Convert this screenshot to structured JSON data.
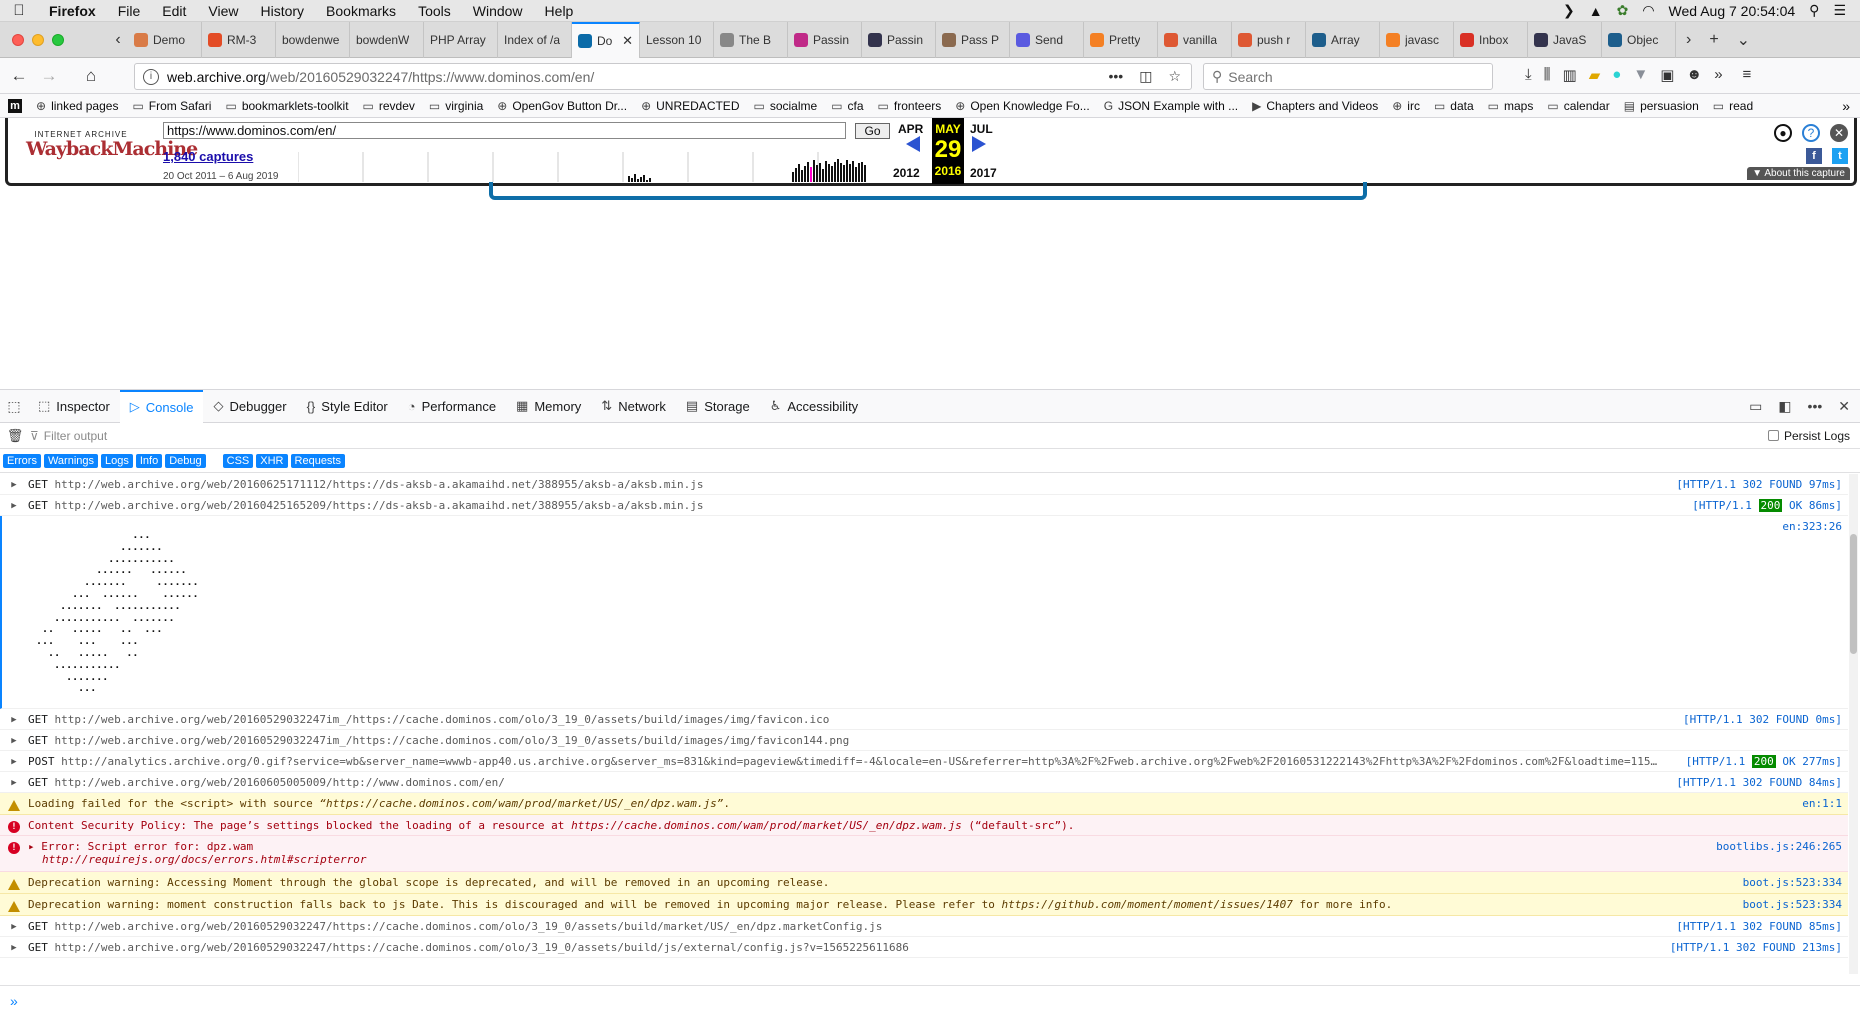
{
  "menubar": {
    "app": "Firefox",
    "items": [
      "File",
      "Edit",
      "View",
      "History",
      "Bookmarks",
      "Tools",
      "Window",
      "Help"
    ],
    "clock": "Wed Aug 7  20:54:04"
  },
  "tabs": [
    {
      "title": "Demo",
      "icon": "slides-icon",
      "color": "#d97b47"
    },
    {
      "title": "RM-3",
      "icon": "grid-icon",
      "color": "#e34c26"
    },
    {
      "title": "bowdenwe",
      "icon": "",
      "color": ""
    },
    {
      "title": "bowdenW",
      "icon": "",
      "color": ""
    },
    {
      "title": "PHP Array",
      "icon": "",
      "color": ""
    },
    {
      "title": "Index of /a",
      "icon": "",
      "color": ""
    },
    {
      "title": "Do",
      "icon": "dominos-icon",
      "color": "#0b6ba8",
      "active": true
    },
    {
      "title": "Lesson 10",
      "icon": "",
      "color": ""
    },
    {
      "title": "The B",
      "icon": "book-icon",
      "color": "#888888"
    },
    {
      "title": "Passin",
      "icon": "grid-icon",
      "color": "#c02a88"
    },
    {
      "title": "Passin",
      "icon": "dw-icon",
      "color": "#33334d"
    },
    {
      "title": "Pass P",
      "icon": "avatar-icon",
      "color": "#8b6a4f"
    },
    {
      "title": "Send",
      "icon": "send-icon",
      "color": "#5a5ae0"
    },
    {
      "title": "Pretty",
      "icon": "stack-icon",
      "color": "#f48024"
    },
    {
      "title": "vanilla",
      "icon": "ddg-icon",
      "color": "#de5833"
    },
    {
      "title": "push r",
      "icon": "ddg-icon",
      "color": "#de5833"
    },
    {
      "title": "Array",
      "icon": "mdn-icon",
      "color": "#1d5e8c"
    },
    {
      "title": "javasc",
      "icon": "stack-icon",
      "color": "#f48024"
    },
    {
      "title": "Inbox",
      "icon": "gmail-icon",
      "color": "#d93025"
    },
    {
      "title": "JavaS",
      "icon": "dw-icon",
      "color": "#33334d"
    },
    {
      "title": "Objec",
      "icon": "mdn-icon",
      "color": "#1d5e8c"
    }
  ],
  "url": {
    "domain": "web.archive.org",
    "path": "/web/20160529032247/https://www.dominos.com/en/"
  },
  "search": {
    "placeholder": "Search"
  },
  "bookmarks": [
    {
      "label": "linked pages",
      "icon": "globe-icon"
    },
    {
      "label": "From Safari",
      "icon": "folder-icon"
    },
    {
      "label": "bookmarklets-toolkit",
      "icon": "folder-icon"
    },
    {
      "label": "revdev",
      "icon": "folder-icon"
    },
    {
      "label": "virginia",
      "icon": "folder-icon"
    },
    {
      "label": "OpenGov Button Dr...",
      "icon": "globe-icon"
    },
    {
      "label": "UNREDACTED",
      "icon": "globe-icon"
    },
    {
      "label": "socialme",
      "icon": "folder-icon"
    },
    {
      "label": "cfa",
      "icon": "folder-icon"
    },
    {
      "label": "fronteers",
      "icon": "folder-icon"
    },
    {
      "label": "Open Knowledge Fo...",
      "icon": "globe-icon"
    },
    {
      "label": "JSON Example with ...",
      "icon": "g-icon"
    },
    {
      "label": "Chapters and Videos",
      "icon": "video-icon"
    },
    {
      "label": "irc",
      "icon": "globe-icon"
    },
    {
      "label": "data",
      "icon": "folder-icon"
    },
    {
      "label": "maps",
      "icon": "folder-icon"
    },
    {
      "label": "calendar",
      "icon": "folder-icon"
    },
    {
      "label": "persuasion",
      "icon": "page-icon"
    },
    {
      "label": "read",
      "icon": "folder-icon"
    }
  ],
  "wayback": {
    "logo_top": "INTERNET ARCHIVE",
    "logo_main": "WaybackMachine",
    "url_value": "https://www.dominos.com/en/",
    "go": "Go",
    "captures": "1,840 captures",
    "range": "20 Oct 2011 – 6 Aug 2019",
    "prev_month": "APR",
    "cur_month": "MAY",
    "next_month": "JUL",
    "prev_year": "2012",
    "cur_day": "29",
    "cur_year": "2016",
    "next_year": "2017",
    "about": "About this capture"
  },
  "devtools": {
    "tabs": [
      {
        "label": "Inspector",
        "icon": "inspector-icon"
      },
      {
        "label": "Console",
        "icon": "console-icon",
        "active": true
      },
      {
        "label": "Debugger",
        "icon": "debugger-icon"
      },
      {
        "label": "Style Editor",
        "icon": "braces-icon"
      },
      {
        "label": "Performance",
        "icon": "gauge-icon"
      },
      {
        "label": "Memory",
        "icon": "memory-icon"
      },
      {
        "label": "Network",
        "icon": "network-icon"
      },
      {
        "label": "Storage",
        "icon": "storage-icon"
      },
      {
        "label": "Accessibility",
        "icon": "accessibility-icon"
      }
    ],
    "filter_placeholder": "Filter output",
    "persist_logs": "Persist Logs",
    "categories": [
      "Errors",
      "Warnings",
      "Logs",
      "Info",
      "Debug"
    ],
    "net_categories": [
      "CSS",
      "XHR",
      "Requests"
    ]
  },
  "console": [
    {
      "kind": "net",
      "method": "GET",
      "url": "http://web.archive.org/web/20160625171112/https://ds-aksb-a.akamaihd.net/388955/aksb-a/aksb.min.js",
      "loc": "[HTTP/1.1  302 FOUND 97ms]"
    },
    {
      "kind": "net",
      "method": "GET",
      "url": "http://web.archive.org/web/20160425165209/https://ds-aksb-a.akamaihd.net/388955/aksb-a/aksb.min.js",
      "loc_pre": "[HTTP/1.1 ",
      "status": "200",
      "loc_post": " OK 86ms]"
    },
    {
      "kind": "ascii",
      "loc": "en:323:26",
      "art": "                 ...\n               .......\n             ...........\n           ......   ......\n         .......     .......\n       ...  ......    ......\n     .......  ...........\n    ...........  .......\n  ..   .....   ..  ...\n ...    ...    ...\n   ..   .....   ..\n    ...........\n      .......\n        ..."
    },
    {
      "kind": "net",
      "method": "GET",
      "url": "http://web.archive.org/web/20160529032247im_/https://cache.dominos.com/olo/3_19_0/assets/build/images/img/favicon.ico",
      "loc": "[HTTP/1.1  302 FOUND 0ms]"
    },
    {
      "kind": "net",
      "method": "GET",
      "url": "http://web.archive.org/web/20160529032247im_/https://cache.dominos.com/olo/3_19_0/assets/build/images/img/favicon144.png",
      "loc": ""
    },
    {
      "kind": "net",
      "method": "POST",
      "url": "http://analytics.archive.org/0.gif?service=wb&server_name=wwwb-app40.us.archive.org&server_ms=831&kind=pageview&timediff=-4&locale=en-US&referrer=http%3A%2F%2Fweb.archive.org%2Fweb%2F20160531222143%2Fhttp%3A%2F%2Fdominos.com%2F&loadtime=115…",
      "loc_pre": "[HTTP/1.1 ",
      "status": "200",
      "loc_post": " OK 277ms]"
    },
    {
      "kind": "net",
      "method": "GET",
      "url": "http://web.archive.org/web/20160605005009/http://www.dominos.com/en/",
      "loc": "[HTTP/1.1  302 FOUND 84ms]"
    },
    {
      "kind": "warn",
      "text_a": "Loading failed for the <script> with source ",
      "text_it": "“https://cache.dominos.com/wam/prod/market/US/_en/dpz.wam.js”",
      "text_b": ".",
      "loc": "en:1:1"
    },
    {
      "kind": "err",
      "text_a": "Content Security Policy: The page’s settings blocked the loading of a resource at ",
      "text_it": "https://cache.dominos.com/wam/prod/market/US/_en/dpz.wam.js",
      "text_b": " (“default-src”).",
      "loc": ""
    },
    {
      "kind": "err2",
      "text_a": "Error: Script error for: dpz.wam",
      "text_it": "http://requirejs.org/docs/errors.html#scripterror",
      "loc": "bootlibs.js:246:265"
    },
    {
      "kind": "warn",
      "text_a": "Deprecation warning: Accessing Moment through the global scope is deprecated, and will be removed in an upcoming release.",
      "text_it": "",
      "text_b": "",
      "loc": "boot.js:523:334"
    },
    {
      "kind": "warn",
      "text_a": "Deprecation warning: moment construction falls back to js Date. This is discouraged and will be removed in upcoming major release. Please refer to ",
      "text_it": "https://github.com/moment/moment/issues/1407",
      "text_b": " for more info.",
      "loc": "boot.js:523:334"
    },
    {
      "kind": "net",
      "method": "GET",
      "url": "http://web.archive.org/web/20160529032247/https://cache.dominos.com/olo/3_19_0/assets/build/market/US/_en/dpz.marketConfig.js",
      "loc": "[HTTP/1.1  302 FOUND 85ms]"
    },
    {
      "kind": "net",
      "method": "GET",
      "url": "http://web.archive.org/web/20160529032247/https://cache.dominos.com/olo/3_19_0/assets/build/js/external/config.js?v=1565225611686",
      "loc": "[HTTP/1.1  302 FOUND 213ms]"
    }
  ],
  "console_prompt": "»"
}
